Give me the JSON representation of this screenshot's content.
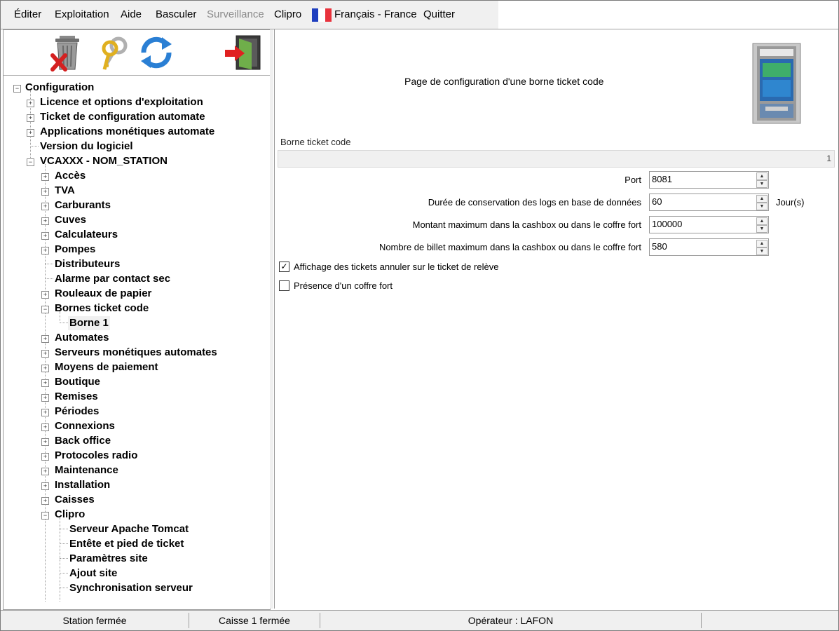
{
  "menu": {
    "items": [
      "Éditer",
      "Exploitation",
      "Aide",
      "Basculer",
      "Surveillance",
      "Clipro",
      "Français - France",
      "Quitter"
    ]
  },
  "toolbar": {
    "icons": [
      "trash-delete-icon",
      "keys-icon",
      "refresh-icon",
      "exit-door-icon"
    ]
  },
  "tree": {
    "items": [
      "Configuration",
      "Licence et options d'exploitation",
      "Ticket de configuration automate",
      "Applications monétiques automate",
      "Version du logiciel",
      "VCAXXX - NOM_STATION",
      "Accès",
      "TVA",
      "Carburants",
      "Cuves",
      "Calculateurs",
      "Pompes",
      "Distributeurs",
      "Alarme par contact sec",
      "Rouleaux de papier",
      "Bornes ticket code",
      "Borne 1",
      "Automates",
      "Serveurs monétiques automates",
      "Moyens de paiement",
      "Boutique",
      "Remises",
      "Périodes",
      "Connexions",
      "Back office",
      "Protocoles radio",
      "Maintenance",
      "Installation",
      "Caisses",
      "Clipro",
      "Serveur Apache Tomcat",
      "Entête et pied de ticket",
      "Paramètres site",
      "Ajout site",
      "Synchronisation serveur"
    ]
  },
  "main": {
    "page_title": "Page de configuration d'une borne ticket code",
    "section_label": "Borne ticket code",
    "section_value": "1",
    "fields": [
      {
        "label": "Port",
        "value": "8081",
        "unit": ""
      },
      {
        "label": "Durée de conservation des logs en base de données",
        "value": "60",
        "unit": "Jour(s)"
      },
      {
        "label": "Montant maximum dans la cashbox ou dans le coffre fort",
        "value": "100000",
        "unit": ""
      },
      {
        "label": "Nombre de billet maximum dans la cashbox ou dans le coffre fort",
        "value": "580",
        "unit": ""
      }
    ],
    "checkboxes": [
      {
        "label": "Affichage des tickets annuler sur le ticket de relève",
        "checked": true
      },
      {
        "label": "Présence d'un coffre fort",
        "checked": false
      }
    ]
  },
  "status": {
    "station": "Station fermée",
    "caisse": "Caisse 1 fermée",
    "operator": "Opérateur : LAFON"
  },
  "colors": {
    "flag_blue": "#1f3fbf",
    "flag_white": "#ffffff",
    "flag_red": "#e8323c",
    "panel_bg": "#f0f0f0"
  }
}
